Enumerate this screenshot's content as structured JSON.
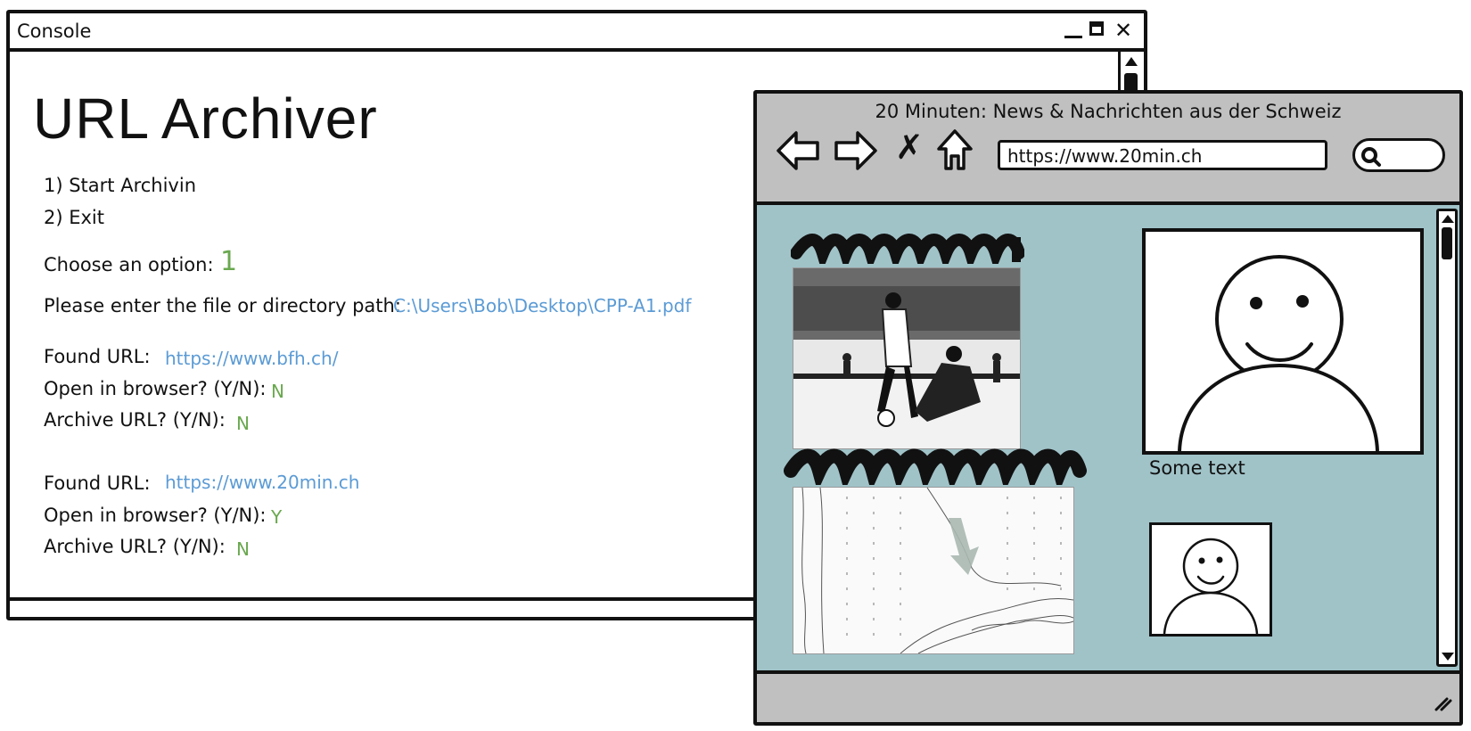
{
  "console": {
    "title": "Console",
    "app_title": "URL Archiver",
    "menu": [
      "1) Start Archivin",
      "2) Exit"
    ],
    "choose_label": "Choose an option:",
    "choose_value": "1",
    "path_label": "Please enter the file or directory path:",
    "path_value": "C:\\Users\\Bob\\Desktop\\CPP-A1.pdf",
    "entries": [
      {
        "found_label": "Found URL:",
        "url": "https://www.bfh.ch/",
        "open_label": "Open in browser? (Y/N):",
        "open_value": "N",
        "archive_label": "Archive URL? (Y/N):",
        "archive_value": "N"
      },
      {
        "found_label": "Found URL:",
        "url": "https://www.20min.ch",
        "open_label": "Open in browser? (Y/N):",
        "open_value": "Y",
        "archive_label": "Archive URL? (Y/N):",
        "archive_value": "N"
      }
    ]
  },
  "browser": {
    "title": "20 Minuten: News & Nachrichten aus der Schweiz",
    "url": "https://www.20min.ch",
    "caption": "Some text"
  },
  "colors": {
    "input_green": "#6aa84f",
    "link_blue": "#5b9bd5",
    "browser_chrome": "#c0c0c0",
    "page_background": "#a0c3c8"
  }
}
